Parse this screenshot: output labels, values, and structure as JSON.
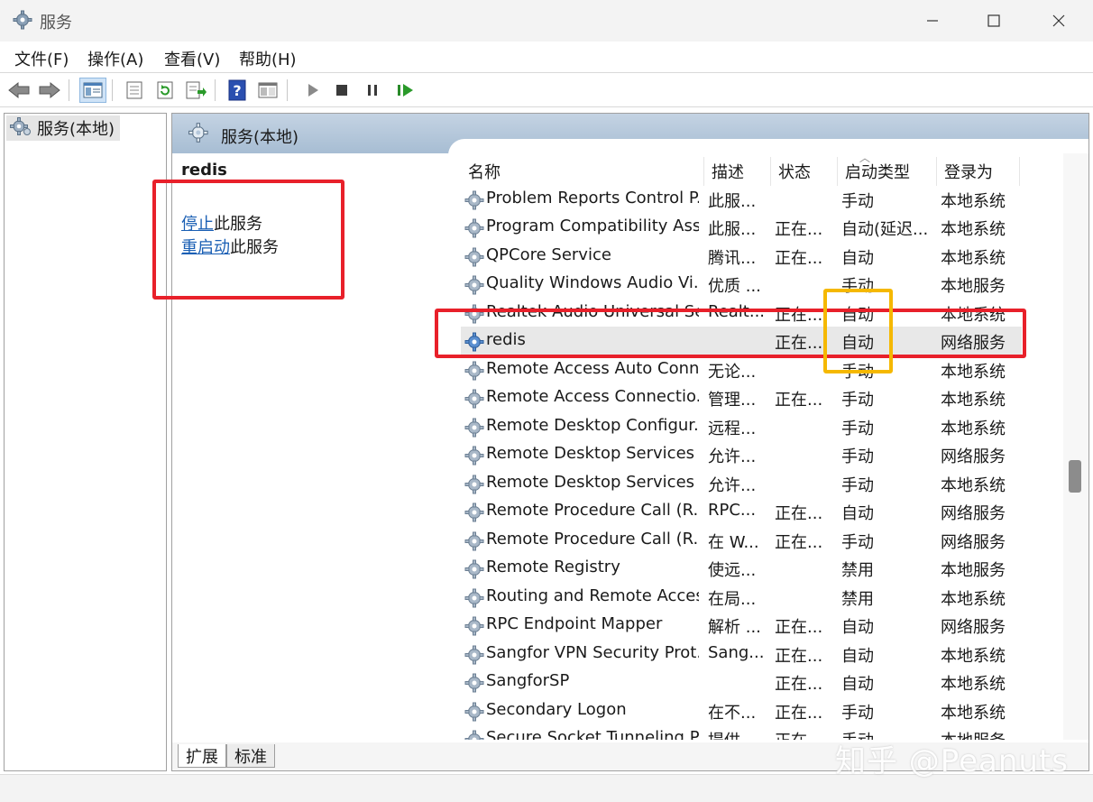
{
  "window": {
    "title": "服务"
  },
  "menu": {
    "file": "文件(F)",
    "action": "操作(A)",
    "view": "查看(V)",
    "help": "帮助(H)"
  },
  "tree": {
    "root_label": "服务(本地)"
  },
  "main": {
    "header_title": "服务(本地)",
    "selected_service": "redis",
    "stop_link": "停止",
    "stop_suffix": "此服务",
    "restart_link": "重启动",
    "restart_suffix": "此服务"
  },
  "columns": {
    "name": "名称",
    "desc": "描述",
    "status": "状态",
    "startup": "启动类型",
    "logon": "登录为"
  },
  "services": [
    {
      "name": "Problem Reports Control P...",
      "desc": "此服...",
      "status": "",
      "startup": "手动",
      "logon": "本地系统"
    },
    {
      "name": "Program Compatibility Assi...",
      "desc": "此服...",
      "status": "正在...",
      "startup": "自动(延迟...",
      "logon": "本地系统"
    },
    {
      "name": "QPCore Service",
      "desc": "腾讯...",
      "status": "正在...",
      "startup": "自动",
      "logon": "本地系统"
    },
    {
      "name": "Quality Windows Audio Vi...",
      "desc": "优质 ...",
      "status": "",
      "startup": "手动",
      "logon": "本地服务"
    },
    {
      "name": "Realtek Audio Universal Se...",
      "desc": "Realt...",
      "status": "正在...",
      "startup": "自动",
      "logon": "本地系统"
    },
    {
      "name": "redis",
      "desc": "",
      "status": "正在...",
      "startup": "自动",
      "logon": "网络服务"
    },
    {
      "name": "Remote Access Auto Conn...",
      "desc": "无论...",
      "status": "",
      "startup": "手动",
      "logon": "本地系统"
    },
    {
      "name": "Remote Access Connectio...",
      "desc": "管理...",
      "status": "正在...",
      "startup": "手动",
      "logon": "本地系统"
    },
    {
      "name": "Remote Desktop Configur...",
      "desc": "远程...",
      "status": "",
      "startup": "手动",
      "logon": "本地系统"
    },
    {
      "name": "Remote Desktop Services",
      "desc": "允许...",
      "status": "",
      "startup": "手动",
      "logon": "网络服务"
    },
    {
      "name": "Remote Desktop Services ...",
      "desc": "允许...",
      "status": "",
      "startup": "手动",
      "logon": "本地系统"
    },
    {
      "name": "Remote Procedure Call (R...",
      "desc": "RPC...",
      "status": "正在...",
      "startup": "自动",
      "logon": "网络服务"
    },
    {
      "name": "Remote Procedure Call (R...",
      "desc": "在 W...",
      "status": "正在...",
      "startup": "手动",
      "logon": "网络服务"
    },
    {
      "name": "Remote Registry",
      "desc": "使远...",
      "status": "",
      "startup": "禁用",
      "logon": "本地服务"
    },
    {
      "name": "Routing and Remote Access",
      "desc": "在局...",
      "status": "",
      "startup": "禁用",
      "logon": "本地系统"
    },
    {
      "name": "RPC Endpoint Mapper",
      "desc": "解析 ...",
      "status": "正在...",
      "startup": "自动",
      "logon": "网络服务"
    },
    {
      "name": "Sangfor VPN Security Prot...",
      "desc": "Sang...",
      "status": "正在...",
      "startup": "自动",
      "logon": "本地系统"
    },
    {
      "name": "SangforSP",
      "desc": "",
      "status": "正在...",
      "startup": "自动",
      "logon": "本地系统"
    },
    {
      "name": "Secondary Logon",
      "desc": "在不...",
      "status": "正在...",
      "startup": "手动",
      "logon": "本地系统"
    },
    {
      "name": "Secure Socket Tunneling P...",
      "desc": "提供...",
      "status": "正在...",
      "startup": "手动",
      "logon": "本地服务"
    }
  ],
  "tabs": {
    "extended": "扩展",
    "standard": "标准"
  },
  "watermark": "知乎 @Peanuts",
  "colors": {
    "annotation_red": "#e8202a",
    "annotation_yellow": "#f5b800",
    "link": "#1a5fb4",
    "header_bg": "#b5c8dc"
  }
}
